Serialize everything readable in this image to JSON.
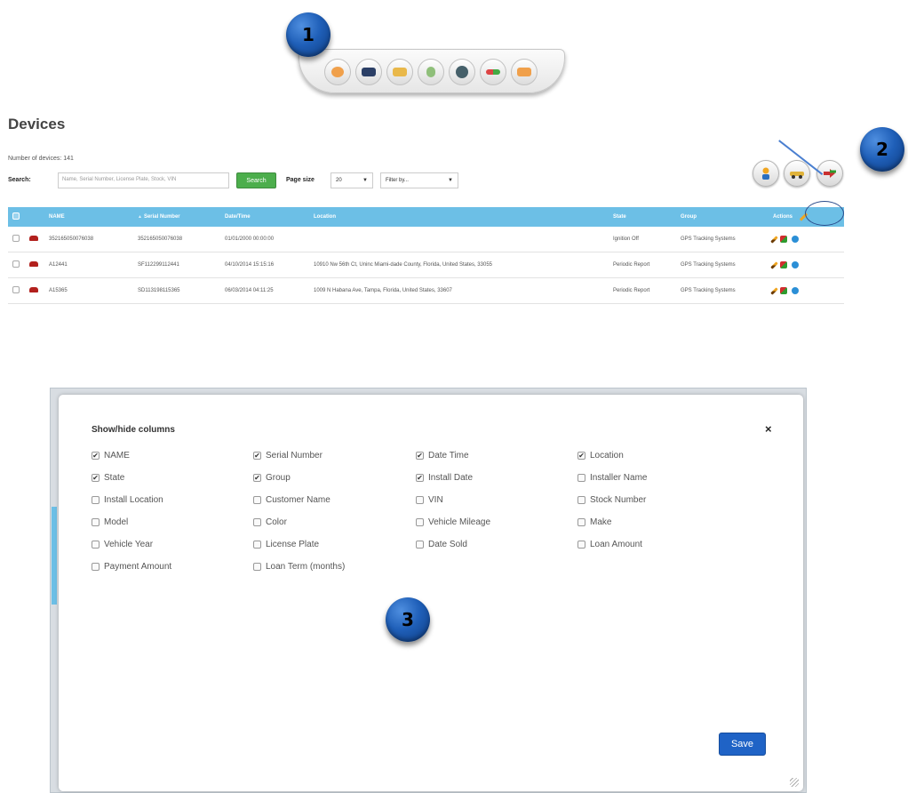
{
  "annotations": {
    "marker_1": "1",
    "marker_2": "2",
    "marker_3": "3"
  },
  "toolbar": {
    "icons": [
      "chat-bubble-icon",
      "vehicle-icon",
      "map-report-icon",
      "user-icon",
      "globe-icon",
      "route-icon",
      "card-icon"
    ]
  },
  "devices": {
    "title": "Devices",
    "count_text": "Number of devices: 141",
    "search_label": "Search:",
    "search_placeholder": "Name, Serial Number, License Plate, Stock, VIN",
    "search_button": "Search",
    "pagesize_label": "Page size",
    "pagesize_value": "20",
    "filter_value": "Filter by...",
    "action_icons": [
      "assign-user-icon",
      "vehicle-icon",
      "swap-icon"
    ]
  },
  "table": {
    "columns": [
      "NAME",
      "Serial Number",
      "Date/Time",
      "Location",
      "State",
      "Group",
      "Actions"
    ],
    "rows": [
      {
        "name": "352165050076038",
        "serial": "352165050076038",
        "date": "01/01/2000 00:00:00",
        "location": "",
        "state": "Ignition Off",
        "group": "GPS Tracking Systems"
      },
      {
        "name": "A12441",
        "serial": "SF112299112441",
        "date": "04/10/2014 15:15:16",
        "location": "10910 Nw 56th Ct, Uninc Miami-dade County, Florida, United States, 33055",
        "state": "Periodic Report",
        "group": "GPS Tracking Systems"
      },
      {
        "name": "A15365",
        "serial": "SD113198115365",
        "date": "06/03/2014 04:11:25",
        "location": "1009 N Habana Ave, Tampa, Florida, United States, 33607",
        "state": "Periodic Report",
        "group": "GPS Tracking Systems"
      }
    ]
  },
  "modal": {
    "title": "Show/hide columns",
    "close": "×",
    "save": "Save",
    "options": [
      {
        "label": "NAME",
        "checked": true
      },
      {
        "label": "Serial Number",
        "checked": true
      },
      {
        "label": "Date Time",
        "checked": true
      },
      {
        "label": "Location",
        "checked": true
      },
      {
        "label": "State",
        "checked": true
      },
      {
        "label": "Group",
        "checked": true
      },
      {
        "label": "Install Date",
        "checked": true
      },
      {
        "label": "Installer Name",
        "checked": false
      },
      {
        "label": "Install Location",
        "checked": false
      },
      {
        "label": "Customer Name",
        "checked": false
      },
      {
        "label": "VIN",
        "checked": false
      },
      {
        "label": "Stock Number",
        "checked": false
      },
      {
        "label": "Model",
        "checked": false
      },
      {
        "label": "Color",
        "checked": false
      },
      {
        "label": "Vehicle Mileage",
        "checked": false
      },
      {
        "label": "Make",
        "checked": false
      },
      {
        "label": "Vehicle Year",
        "checked": false
      },
      {
        "label": "License Plate",
        "checked": false
      },
      {
        "label": "Date Sold",
        "checked": false
      },
      {
        "label": "Loan Amount",
        "checked": false
      },
      {
        "label": "Payment Amount",
        "checked": false
      },
      {
        "label": "Loan Term (months)",
        "checked": false
      }
    ]
  },
  "colors": {
    "header_blue": "#6cbfe6",
    "search_green": "#4cae4c",
    "save_blue": "#1f63c6",
    "callout_blue": "#1f5fb8"
  }
}
